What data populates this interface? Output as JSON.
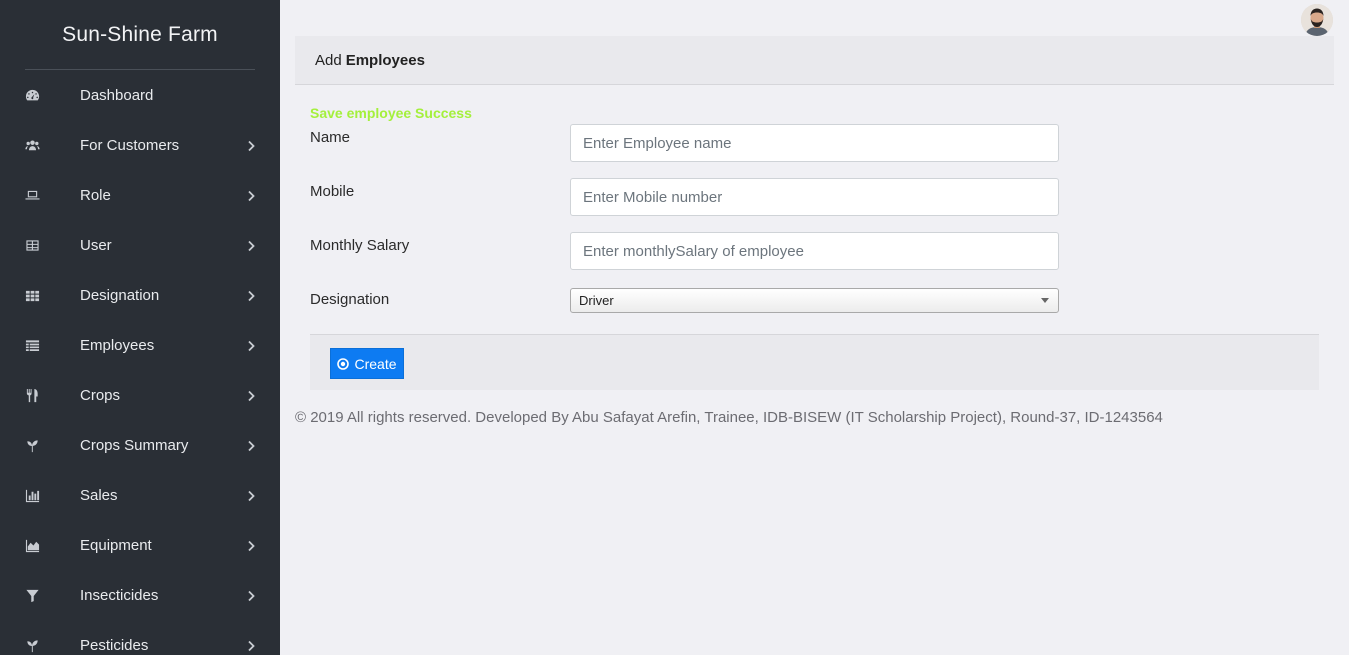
{
  "app": {
    "title": "Sun-Shine Farm"
  },
  "sidebar": {
    "items": [
      {
        "label": "Dashboard",
        "icon": "dashboard-icon",
        "has_submenu": false
      },
      {
        "label": "For Customers",
        "icon": "users-icon",
        "has_submenu": true
      },
      {
        "label": "Role",
        "icon": "laptop-icon",
        "has_submenu": true
      },
      {
        "label": "User",
        "icon": "table-icon",
        "has_submenu": true
      },
      {
        "label": "Designation",
        "icon": "grid-icon",
        "has_submenu": true
      },
      {
        "label": "Employees",
        "icon": "list-icon",
        "has_submenu": true
      },
      {
        "label": "Crops",
        "icon": "utensils-icon",
        "has_submenu": true
      },
      {
        "label": "Crops Summary",
        "icon": "seedling-icon",
        "has_submenu": true
      },
      {
        "label": "Sales",
        "icon": "bar-chart-icon",
        "has_submenu": true
      },
      {
        "label": "Equipment",
        "icon": "area-chart-icon",
        "has_submenu": true
      },
      {
        "label": "Insecticides",
        "icon": "filter-icon",
        "has_submenu": true
      },
      {
        "label": "Pesticides",
        "icon": "seedling-icon",
        "has_submenu": true
      }
    ]
  },
  "header": {
    "avatar": "user-avatar"
  },
  "card": {
    "title_prefix": "Add",
    "title_bold": "Employees",
    "success_message": "Save employee Success"
  },
  "form": {
    "name": {
      "label": "Name",
      "placeholder": "Enter Employee name",
      "value": ""
    },
    "mobile": {
      "label": "Mobile",
      "placeholder": "Enter Mobile number",
      "value": ""
    },
    "salary": {
      "label": "Monthly Salary",
      "placeholder": "Enter monthlySalary of employee",
      "value": ""
    },
    "designation": {
      "label": "Designation",
      "selected": "Driver"
    },
    "create_label": "Create"
  },
  "footer": {
    "text": "© 2019 All rights reserved. Developed By Abu Safayat Arefin, Trainee, IDB-BISEW (IT Scholarship Project), Round-37, ID-1243564"
  },
  "colors": {
    "sidebar_bg": "#2a2f36",
    "page_bg": "#f0f0f4",
    "success": "#a4f03c",
    "primary": "#0d7bf2"
  }
}
